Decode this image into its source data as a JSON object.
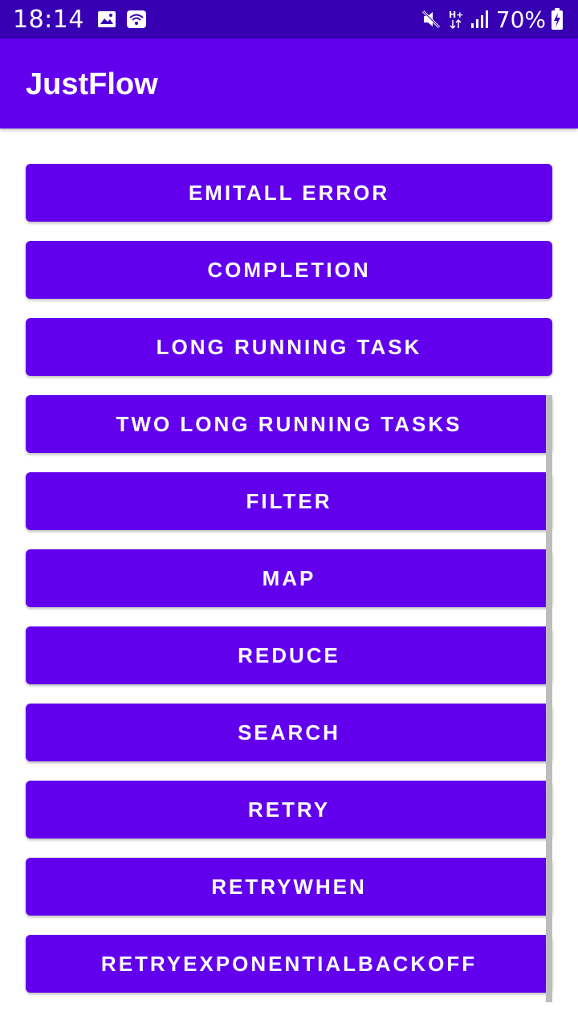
{
  "status_bar": {
    "time": "18:14",
    "battery": "70%",
    "icons": [
      "image-icon",
      "wifi-icon",
      "mute-icon",
      "hplus-data-icon",
      "signal-icon",
      "battery-charging-icon"
    ]
  },
  "app_bar": {
    "title": "JustFlow"
  },
  "buttons": [
    "EMITALL ERROR",
    "COMPLETION",
    "LONG RUNNING TASK",
    "TWO LONG RUNNING TASKS",
    "FILTER",
    "MAP",
    "REDUCE",
    "SEARCH",
    "RETRY",
    "RETRYWHEN",
    "RETRYEXPONENTIALBACKOFF"
  ],
  "colors": {
    "status_bar": "#3700b3",
    "primary": "#6200ee",
    "text_on_primary": "#ffffff",
    "background": "#ffffff"
  }
}
